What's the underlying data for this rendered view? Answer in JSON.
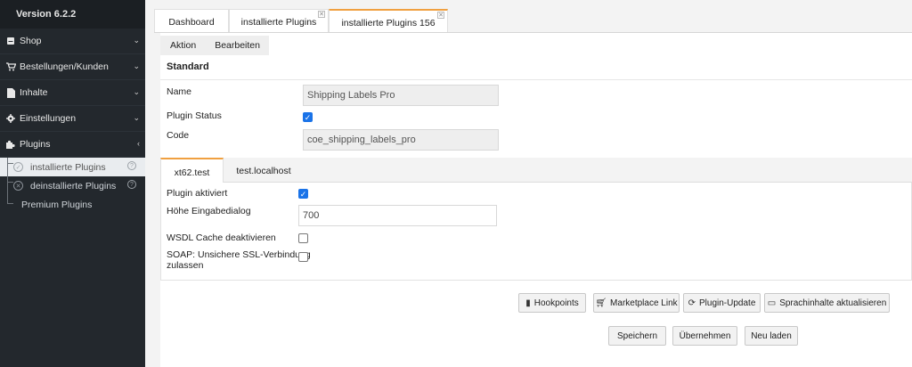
{
  "sidebar": {
    "version": "Version 6.2.2",
    "items": [
      {
        "label": "Shop",
        "icon": "shop-icon",
        "chevron": "⌄"
      },
      {
        "label": "Bestellungen/Kunden",
        "icon": "cart-icon",
        "chevron": "⌄"
      },
      {
        "label": "Inhalte",
        "icon": "document-icon",
        "chevron": "⌄"
      },
      {
        "label": "Einstellungen",
        "icon": "gear-icon",
        "chevron": "⌄"
      },
      {
        "label": "Plugins",
        "icon": "puzzle-icon",
        "chevron": "‹"
      }
    ],
    "subitems": [
      {
        "label": "installierte Plugins",
        "active": true
      },
      {
        "label": "deinstallierte Plugins",
        "active": false
      },
      {
        "label": "Premium Plugins",
        "active": false
      }
    ]
  },
  "tabs": [
    {
      "label": "Dashboard"
    },
    {
      "label": "installierte Plugins"
    },
    {
      "label": "installierte Plugins 156",
      "active": true
    }
  ],
  "toolbar": {
    "action": "Aktion",
    "edit": "Bearbeiten"
  },
  "form": {
    "section": "Standard",
    "name_label": "Name",
    "name_value": "Shipping Labels Pro",
    "status_label": "Plugin Status",
    "status_checked": true,
    "code_label": "Code",
    "code_value": "coe_shipping_labels_pro"
  },
  "store_tabs": [
    {
      "label": "xt62.test",
      "active": true
    },
    {
      "label": "test.localhost",
      "active": false
    }
  ],
  "store_form": {
    "activated_label": "Plugin aktiviert",
    "activated_checked": true,
    "height_label": "Höhe Eingabedialog",
    "height_value": "700",
    "wsdl_label": "WSDL Cache deaktivieren",
    "wsdl_checked": false,
    "soap_label_1": "SOAP: Unsichere SSL-Verbindung",
    "soap_label_2": "zulassen",
    "soap_checked": false
  },
  "actions": {
    "hookpoints": "Hookpoints",
    "marketplace": "Marketplace Link",
    "update": "Plugin-Update",
    "lang": "Sprachinhalte aktualisieren"
  },
  "footer": {
    "save": "Speichern",
    "apply": "Übernehmen",
    "reload": "Neu laden"
  },
  "colors": {
    "sidebar_bg": "#23282d",
    "accent_tab": "#f0a040",
    "checkbox": "#1a73e8"
  }
}
